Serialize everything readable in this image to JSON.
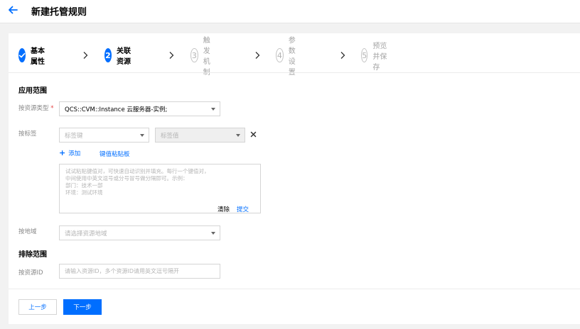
{
  "header": {
    "title": "新建托管规则",
    "back_icon": "arrow-left-icon"
  },
  "steps": [
    {
      "num": "1",
      "label": "基本属性",
      "state": "done"
    },
    {
      "num": "2",
      "label": "关联资源",
      "state": "active"
    },
    {
      "num": "3",
      "label": "触发机制",
      "state": "todo"
    },
    {
      "num": "4",
      "label": "参数设置",
      "state": "todo"
    },
    {
      "num": "5",
      "label": "预览并保存",
      "state": "todo"
    }
  ],
  "scope": {
    "title": "应用范围",
    "resource_type": {
      "label": "按资源类型",
      "required_mark": "*",
      "value": "QCS::CVM::Instance 云服务器-实例;"
    },
    "tags": {
      "label": "按标签",
      "key_placeholder": "标签键",
      "value_placeholder": "标签值",
      "add_label": "添加",
      "paste_label": "键值粘贴板",
      "paste_area": {
        "lines": [
          "试试粘贴键值对，可快速自动识别并填充。每行一个键值对，",
          "中间使用中英文逗号或分号冒号做分隔即可。示例：",
          "部门：技术一部",
          "环境：测试环境"
        ],
        "clear_label": "清除",
        "submit_label": "提交"
      }
    },
    "region": {
      "label": "按地域",
      "placeholder": "请选择资源地域"
    }
  },
  "exclude": {
    "title": "排除范围",
    "resource_id": {
      "label": "按资源ID",
      "placeholder": "请输入资源ID，多个资源ID请用英文逗号隔开"
    }
  },
  "actions": {
    "prev_label": "上一步",
    "next_label": "下一步"
  },
  "colors": {
    "primary": "#006eff",
    "required": "#e54545"
  }
}
